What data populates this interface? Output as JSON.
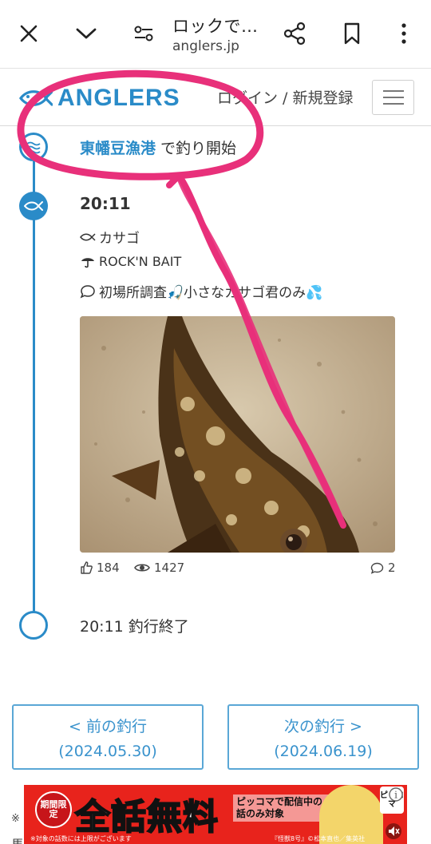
{
  "browser_bar": {
    "title": "ロックで…",
    "url": "anglers.jp"
  },
  "site": {
    "logo_text": "ANGLERS",
    "login_label": "ログイン / 新規登録"
  },
  "timeline": {
    "start": {
      "port_name": "東幡豆漁港",
      "suffix": " で釣り開始"
    },
    "catch": {
      "time": "20:11",
      "species": "カサゴ",
      "lure": "ROCK'N BAIT",
      "comment": "初場所調査🎣小さなカサゴ君のみ💦",
      "likes": "184",
      "views": "1427",
      "comments": "2"
    },
    "end": {
      "label": "20:11 釣行終了"
    }
  },
  "pager": {
    "prev_label": "< 前の釣行",
    "prev_date": "(2024.05.30)",
    "next_label": "次の釣行 >",
    "next_date": "(2024.06.19)"
  },
  "ad": {
    "badge": "期間限定",
    "title": "全話無料",
    "subtitle": "ピッコマで配信中の話のみ対象",
    "fine_left": "※対象の話数には上限がございます",
    "fine_right": "『怪獣8号』©松本直也／集英社",
    "logo": "ピッコマ"
  },
  "footer": {
    "note_mark": "※",
    "stray_char": "馬"
  },
  "colors": {
    "brand_blue": "#2a8bc8",
    "annotation_pink": "#e8307a",
    "ad_red": "#e8231c"
  }
}
